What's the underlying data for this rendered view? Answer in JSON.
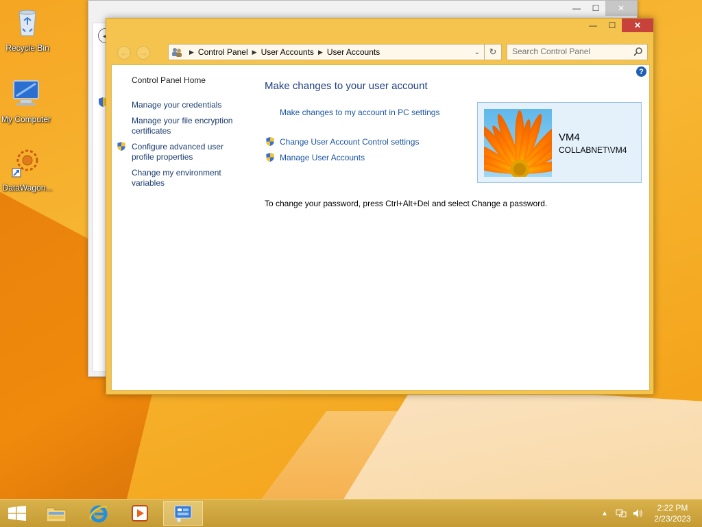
{
  "desktop": {
    "icons": [
      {
        "label": "Recycle Bin"
      },
      {
        "label": "My Computer"
      },
      {
        "label": "DataWagon..."
      }
    ]
  },
  "window": {
    "caption": {
      "minimize": "—",
      "maximize": "☐",
      "close": "✕"
    },
    "address": {
      "crumbs": [
        "Control Panel",
        "User Accounts",
        "User Accounts"
      ]
    },
    "search": {
      "placeholder": "Search Control Panel"
    },
    "left_pane": {
      "home": "Control Panel Home",
      "links": [
        "Manage your credentials",
        "Manage your file encryption certificates",
        "Configure advanced user profile properties",
        "Change my environment variables"
      ]
    },
    "main": {
      "title": "Make changes to your user account",
      "pc_settings_link": "Make changes to my account in PC settings",
      "uac_link": "Change User Account Control settings",
      "manage_link": "Manage User Accounts",
      "password_note": "To change your password, press Ctrl+Alt+Del and select Change a password."
    },
    "user": {
      "name": "VM4",
      "domain": "COLLABNET\\VM4"
    }
  },
  "taskbar": {
    "clock_time": "2:22 PM",
    "clock_date": "2/23/2023"
  },
  "colors": {
    "window_frame": "#f4c44f",
    "link": "#1a55a4",
    "title": "#1e3f85",
    "close_button": "#c7423a"
  }
}
